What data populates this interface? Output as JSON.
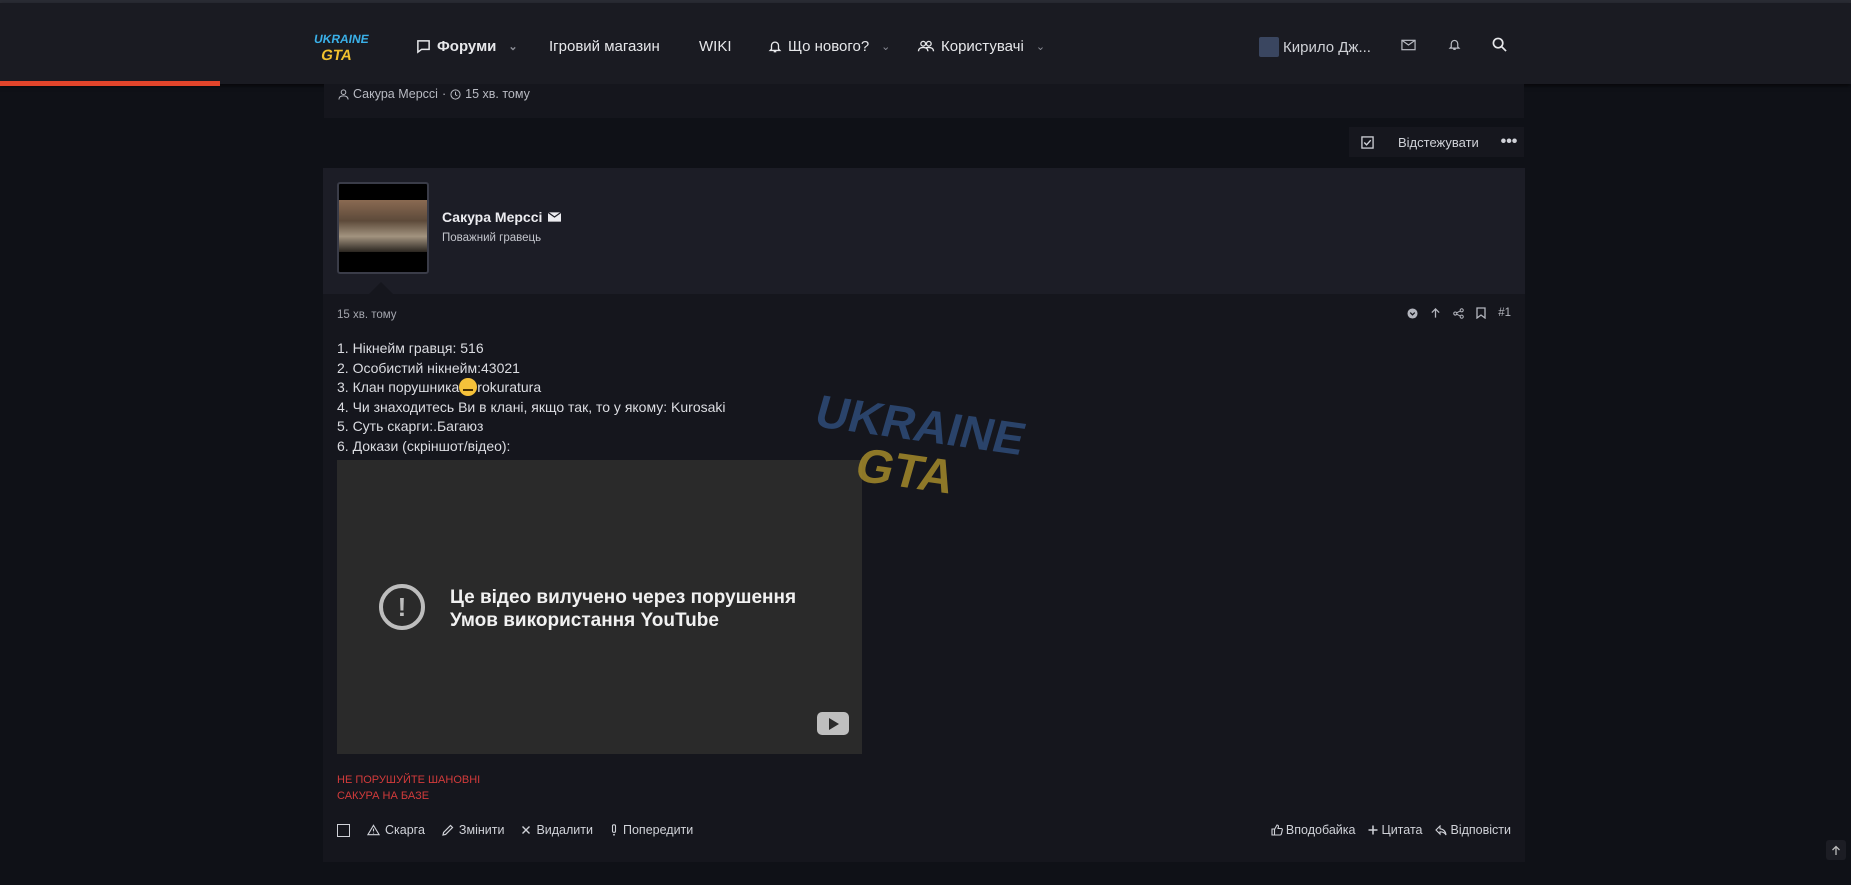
{
  "nav": {
    "logo_text": "UKRAINE GTA",
    "items": [
      {
        "label": "Форуми"
      },
      {
        "label": "Ігровий магазин"
      },
      {
        "label": "WIKI"
      },
      {
        "label": "Що нового?"
      },
      {
        "label": "Користувачі"
      }
    ],
    "username": "Кирило Дж..."
  },
  "prev": {
    "author": "Сакура Мерссі",
    "sep": "·",
    "time": "15 хв. тому"
  },
  "thread": {
    "watch_label": "Відстежувати",
    "more_label": "•••"
  },
  "post": {
    "author": "Сакура Мерссі",
    "author_title": "Поважний гравець",
    "time": "15 хв. тому",
    "number": "#1",
    "lines": [
      "1. Нікнейм гравця: 516",
      "2. Особистий нікнейм:43021",
      "3. Клан порушника",
      "rokuratura",
      "4. Чи знаходитесь Ви в клані, якщо так, то у якому: Kurosaki",
      "5. Суть скарги:.Багаюз",
      "6. Докази (скріншот/відео):"
    ],
    "video_message": "Це відео вилучено через порушення Умов використання YouTube",
    "signature": [
      "НЕ ПОРУШУЙТЕ ШАНОВНІ",
      "САКУРА НА БАЗЕ"
    ],
    "actions_left": {
      "report": "Скарга",
      "edit": "Змінити",
      "delete": "Видалити",
      "warn": "Попередити"
    },
    "actions_right": {
      "like": "Вподобайка",
      "quote": "Цитата",
      "reply": "Відповісти"
    }
  },
  "watermark": {
    "line1": "UKRAINE",
    "line2": "GTA"
  },
  "colors": {
    "accent": "#e2452b",
    "signature": "#d23b3b",
    "bg": "#0f1117",
    "nav": "#1a1b22"
  }
}
